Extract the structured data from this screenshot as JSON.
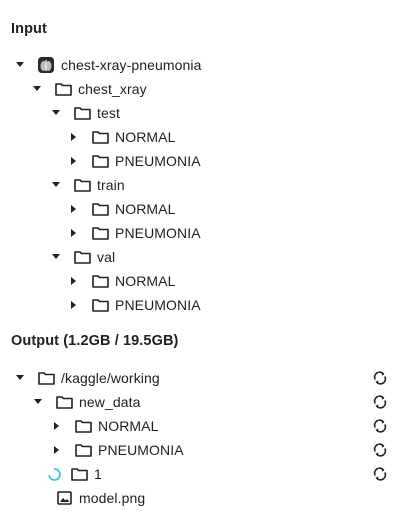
{
  "input": {
    "title": "Input",
    "dataset": "chest-xray-pneumonia",
    "chest_xray": "chest_xray",
    "test": "test",
    "test_children": [
      "NORMAL",
      "PNEUMONIA"
    ],
    "train": "train",
    "train_children": [
      "NORMAL",
      "PNEUMONIA"
    ],
    "val": "val",
    "val_children": [
      "NORMAL",
      "PNEUMONIA"
    ]
  },
  "output": {
    "title": "Output (1.2GB / 19.5GB)",
    "root": "/kaggle/working",
    "new_data": "new_data",
    "new_data_children": [
      "NORMAL",
      "PNEUMONIA"
    ],
    "loading_folder": "1",
    "file": "model.png"
  },
  "icons": {
    "folder": "folder-icon",
    "caret_down": "caret-down-icon",
    "caret_right": "caret-right-icon",
    "sync": "sync-icon",
    "image_file": "image-file-icon",
    "spinner": "loading-spinner-icon",
    "dataset": "dataset-thumbnail-icon"
  },
  "colors": {
    "text": "#202124",
    "icon": "#202124",
    "spinner": "#20beff"
  }
}
